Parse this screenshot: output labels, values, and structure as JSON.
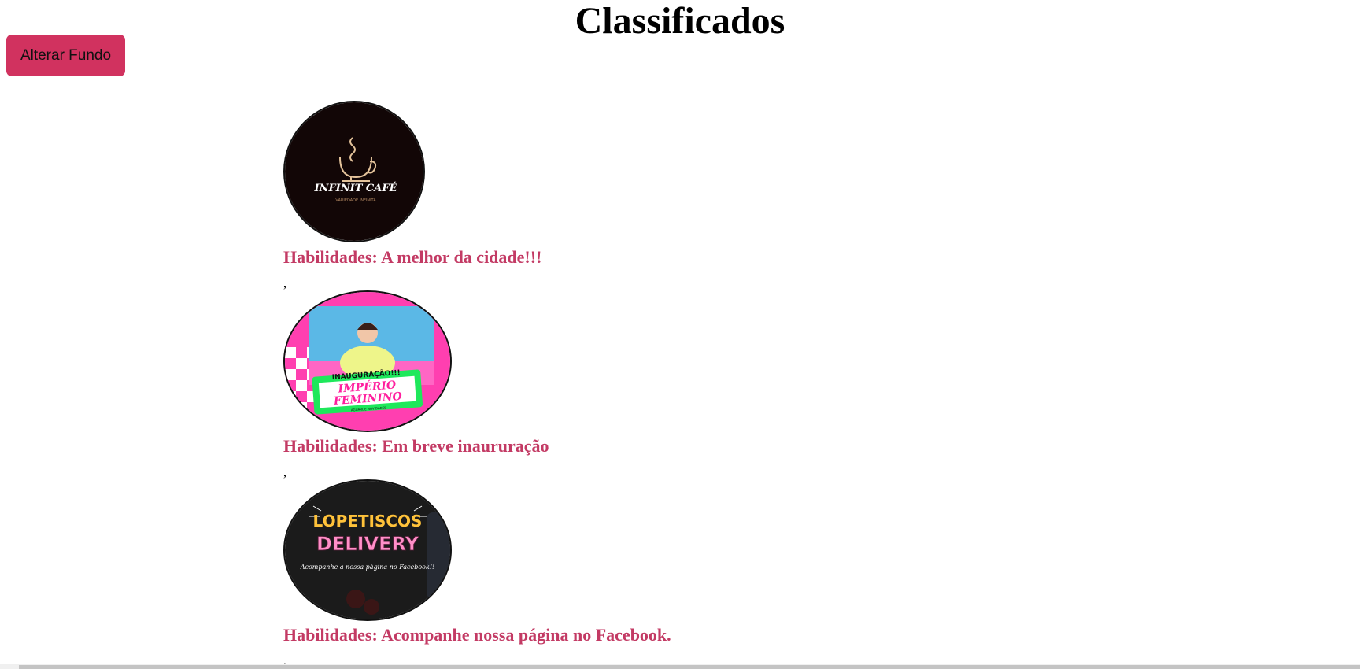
{
  "page": {
    "title": "Classificados",
    "change_background_label": "Alterar Fundo",
    "accent_color": "#d1325f",
    "skill_text_color": "#c33a64"
  },
  "listings": [
    {
      "logo_icon": "infinit-cafe-logo",
      "logo_text": "INFINIT CAFÉ",
      "logo_subtext": "VARIEDADE INFINITA",
      "skill": "Habilidades: A melhor da cidade!!!",
      "separator": ","
    },
    {
      "logo_icon": "imperio-feminino-logo",
      "logo_text": "INAUGURAÇÃO!!!",
      "logo_text2": "IMPÉRIO",
      "logo_text3": "FEMININO",
      "logo_subtext": "AGUARDE NOVIDADES",
      "skill": "Habilidades: Em breve inaururação",
      "separator": ","
    },
    {
      "logo_icon": "lopetiscos-delivery-logo",
      "logo_text": "LOPETISCOS",
      "logo_text2": "DELIVERY",
      "logo_subtext": "Acompanhe a nossa página no Facebook!!",
      "skill": "Habilidades: Acompanhe nossa página no Facebook.",
      "separator": ","
    }
  ]
}
